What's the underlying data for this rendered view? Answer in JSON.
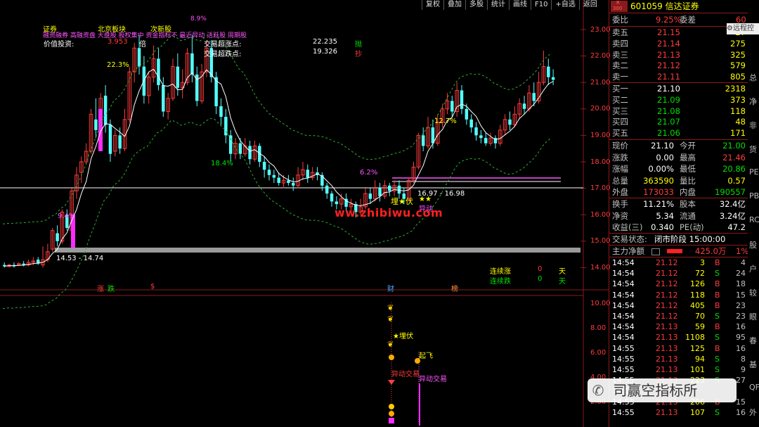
{
  "toolbar": {
    "buttons": [
      "复权",
      "叠加",
      "多股",
      "统计",
      "画线",
      "F10",
      "+自选",
      "返回"
    ]
  },
  "remote": "远程控",
  "stock": {
    "badge_r": "R",
    "badge_num": "300",
    "code_name": "601059 信达证券"
  },
  "header": {
    "weibi_label": "委比",
    "weibi_value": "9.25%",
    "weicha_label": "委差",
    "weicha_value": "60"
  },
  "asks": [
    {
      "label": "卖五",
      "price": "21.15",
      "vol": "27"
    },
    {
      "label": "卖四",
      "price": "21.14",
      "vol": "275"
    },
    {
      "label": "卖三",
      "price": "21.13",
      "vol": "325"
    },
    {
      "label": "卖二",
      "price": "21.12",
      "vol": "579"
    },
    {
      "label": "卖一",
      "price": "21.11",
      "vol": "805"
    }
  ],
  "bids": [
    {
      "label": "买一",
      "price": "21.10",
      "vol": "2318"
    },
    {
      "label": "买二",
      "price": "21.09",
      "vol": "373"
    },
    {
      "label": "买三",
      "price": "21.08",
      "vol": "118"
    },
    {
      "label": "买四",
      "price": "21.07",
      "vol": "48"
    },
    {
      "label": "买五",
      "price": "21.06",
      "vol": "171"
    }
  ],
  "quote_rows": [
    {
      "l1": "现价",
      "v1": "21.10",
      "l2": "今开",
      "v2": "21.00",
      "c2": "grn"
    },
    {
      "l1": "涨跌",
      "v1": "0.00",
      "l2": "最高",
      "v2": "21.46",
      "c2": "red"
    },
    {
      "l1": "涨幅",
      "v1": "0.00%",
      "l2": "最低",
      "v2": "20.86",
      "c2": "grn"
    },
    {
      "l1": "总量",
      "v1": "363590",
      "l2": "量比",
      "v2": "0.57",
      "c2": "yel"
    },
    {
      "l1": "外盘",
      "v1": "173033",
      "l2": "内盘",
      "v2": "190557",
      "c2": "grn"
    }
  ],
  "stats_rows": [
    {
      "l1": "换手",
      "v1": "11.21%",
      "l2": "股本",
      "v2": "32.4亿"
    },
    {
      "l1": "净资",
      "v1": "5.34",
      "l2": "流通",
      "v2": "3.24亿"
    },
    {
      "l1": "收益(三)",
      "v1": "0.340",
      "l2": "PE(动)",
      "v2": "47.2"
    }
  ],
  "trade_status": {
    "label": "交易状态:",
    "value": "闭市阶段 15:00:00"
  },
  "main_flow": {
    "label": "主力净额",
    "value": "425.0万",
    "pct": "1%"
  },
  "ticks": [
    {
      "t": "14:54",
      "p": "21.12",
      "v": "3",
      "d": "B",
      "n": "4",
      "pc": "red",
      "dc": "red"
    },
    {
      "t": "14:54",
      "p": "21.12",
      "v": "72",
      "d": "S",
      "n": "24",
      "pc": "red",
      "dc": "grn"
    },
    {
      "t": "14:54",
      "p": "21.12",
      "v": "126",
      "d": "B",
      "n": "18",
      "pc": "red",
      "dc": "red"
    },
    {
      "t": "14:54",
      "p": "21.12",
      "v": "118",
      "d": "B",
      "n": "15",
      "pc": "red",
      "dc": "red"
    },
    {
      "t": "14:54",
      "p": "21.12",
      "v": "405",
      "d": "B",
      "n": "23",
      "pc": "red",
      "dc": "red"
    },
    {
      "t": "14:54",
      "p": "21.12",
      "v": "70",
      "d": "S",
      "n": "23",
      "pc": "red",
      "dc": "grn"
    },
    {
      "t": "14:54",
      "p": "21.13",
      "v": "59",
      "d": "B",
      "n": "16",
      "pc": "red",
      "dc": "red"
    },
    {
      "t": "14:54",
      "p": "21.13",
      "v": "1108",
      "d": "S",
      "n": "95",
      "pc": "red",
      "dc": "grn"
    },
    {
      "t": "14:55",
      "p": "21.13",
      "v": "125",
      "d": "B",
      "n": "16",
      "pc": "red",
      "dc": "red"
    },
    {
      "t": "14:55",
      "p": "21.13",
      "v": "94",
      "d": "S",
      "n": "8",
      "pc": "red",
      "dc": "grn"
    },
    {
      "t": "14:55",
      "p": "21.13",
      "v": "101",
      "d": "S",
      "n": "9",
      "pc": "red",
      "dc": "grn"
    },
    {
      "t": "14:55",
      "p": "21.13",
      "v": "223",
      "d": "S",
      "n": "27",
      "pc": "red",
      "dc": "grn"
    },
    {
      "t": "14:55",
      "p": "21.13",
      "v": "",
      "d": "",
      "n": "",
      "pc": "red",
      "dc": "red"
    },
    {
      "t": "14:55",
      "p": "21.13",
      "v": "206",
      "d": "B",
      "n": "15",
      "pc": "red",
      "dc": "red"
    },
    {
      "t": "14:55",
      "p": "21.13",
      "v": "107",
      "d": "S",
      "n": "16",
      "pc": "red",
      "dc": "grn"
    }
  ],
  "edge_labels": [
    "总",
    "净",
    "非",
    "货",
    "PE",
    "PB",
    "RC",
    "股",
    "户",
    "较",
    "眼",
    "春",
    "基",
    "QF",
    "外"
  ],
  "chart": {
    "top_tags": [
      "证券",
      "北京板块",
      "次新股"
    ],
    "concept_line": "融资融券 高融资盘 大盘股 股权集中 资金指标不 最近异动 活跃股 周期股",
    "value_label": "价值投资:",
    "value_num": "3.953",
    "value_suffix": "倍",
    "rise_label": "交易超涨点:",
    "rise_value": "22.235",
    "rise_action": "抛",
    "fall_label": "交易超跌点:",
    "fall_value": "19.326",
    "fall_action": "抄",
    "pct_labels": [
      "22.3%",
      "18.4%",
      "9.4%",
      "12.7%",
      "6.2%",
      "8.9%"
    ],
    "range_low": "14.53 - 14.74",
    "range_mid": "16.97 - 16.98",
    "bury_label": "埋★伏",
    "bury_label2": "★★",
    "yidong": "异动",
    "y_axis": [
      "23.00",
      "22.00",
      "21.00",
      "20.00",
      "19.00",
      "18.00",
      "17.00",
      "16.00",
      "15.00",
      "14.00"
    ],
    "lianxu_zhang_label": "连续涨",
    "lianxu_zhang_n": "0",
    "lianxu_die_label": "连续跌",
    "lianxu_die_n": "0",
    "tian": "天",
    "bottom_markers": [
      "涨",
      "跌",
      "$",
      "财",
      "榜"
    ],
    "sub_axis": [
      "10.00",
      "8.00",
      "6.00",
      "4.00",
      "2.00"
    ],
    "sub_labels": {
      "maifu": "★埋伏",
      "qifei": "起飞",
      "yidong1": "异动交易",
      "yidong2": "异动交易"
    },
    "watermark": "ww.zhibiwu.com"
  },
  "watermark_badge": "司赢空指标所"
}
